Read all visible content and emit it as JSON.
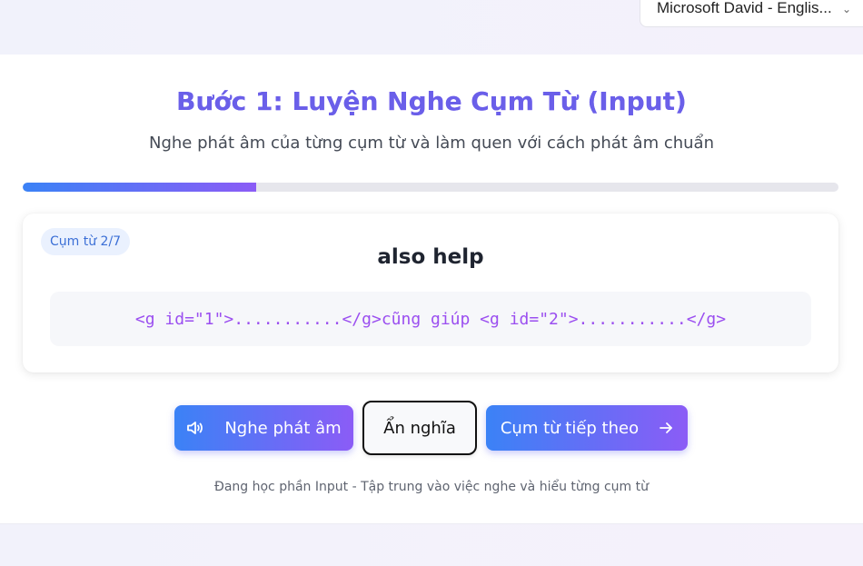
{
  "voice_select": {
    "value": "Microsoft David - Englis..."
  },
  "header": {
    "title": "Bước 1: Luyện Nghe Cụm Từ (Input)",
    "subtitle": "Nghe phát âm của từng cụm từ và làm quen với cách phát âm chuẩn"
  },
  "progress": {
    "fraction": 0.286
  },
  "card": {
    "badge": "Cụm từ 2/7",
    "phrase": "also help",
    "meaning": "<g id=\"1\">...........</g>cũng giúp <g id=\"2\">...........</g>"
  },
  "buttons": {
    "listen": "Nghe phát âm",
    "hide": "Ẩn nghĩa",
    "next": "Cụm từ tiếp theo"
  },
  "footnote": "Đang học phần Input - Tập trung vào việc nghe và hiểu từng cụm từ",
  "icons": {
    "listen": "speaker-icon",
    "next": "arrow-right-icon",
    "select": "chevron-down-icon"
  },
  "colors": {
    "accent_start": "#3b82f6",
    "accent_end": "#8b5cf6",
    "meaning_text": "#9b4ff0"
  }
}
